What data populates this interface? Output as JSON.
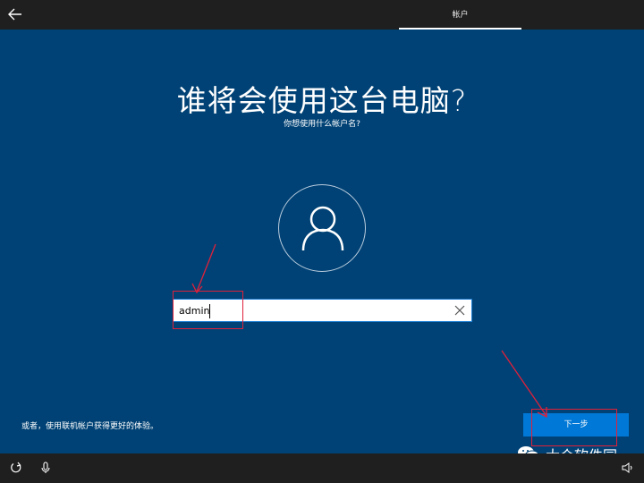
{
  "header": {
    "back_icon": "back-arrow-icon",
    "active_tab": "帐户"
  },
  "main": {
    "title": "谁将会使用这台电脑?",
    "subtitle": "你想使用什么帐户名?",
    "avatar_icon": "user-icon",
    "username_input": {
      "value": "admin",
      "clear_icon": "close-icon"
    },
    "online_account_link": "或者，使用联机帐户获得更好的体验。",
    "next_button": "下一步"
  },
  "watermark": {
    "icon": "wechat-icon",
    "text": "大众软件园"
  },
  "bottom_bar": {
    "icons": [
      "accessibility-icon",
      "microphone-icon",
      "volume-icon"
    ]
  },
  "colors": {
    "background": "#004275",
    "bars": "#1f1f1f",
    "accent": "#0078d7",
    "annotation": "#e0203a"
  }
}
